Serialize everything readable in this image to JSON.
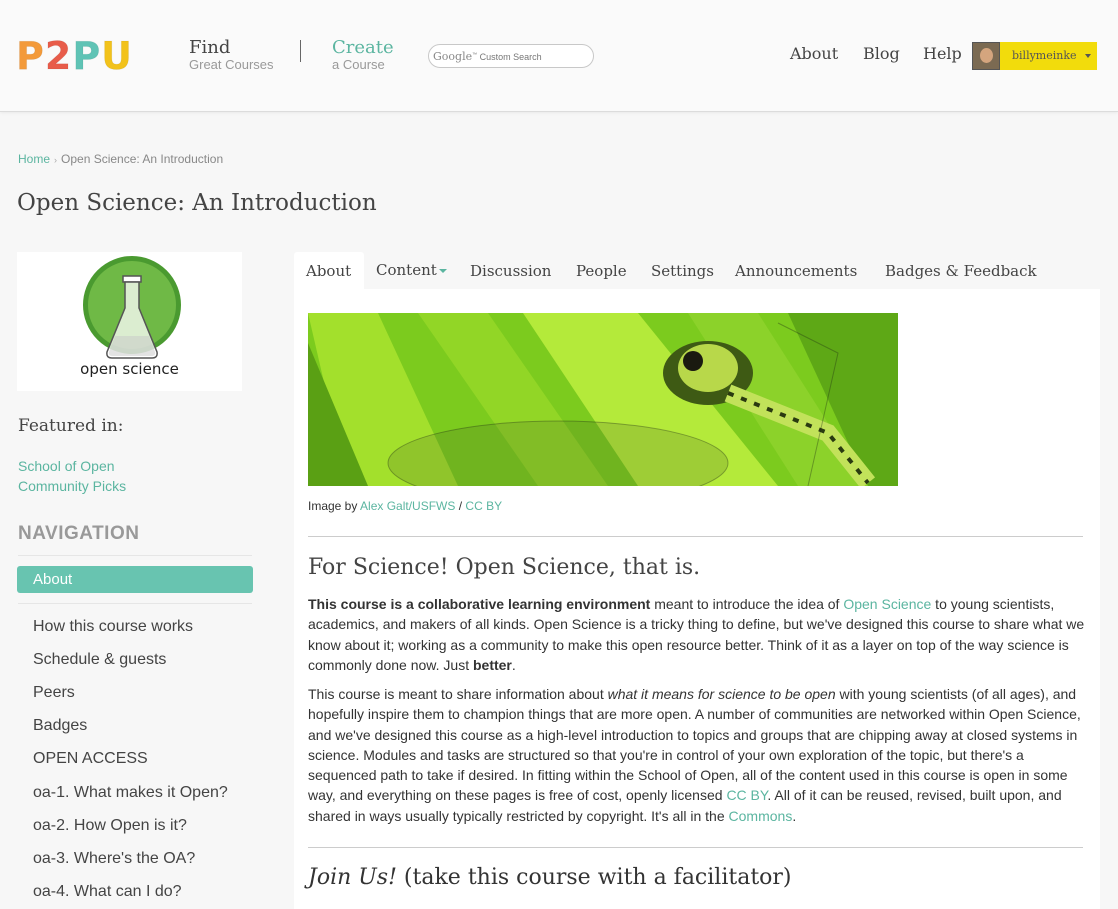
{
  "header": {
    "logo": [
      "P",
      "2",
      "P",
      "U"
    ],
    "find": {
      "title": "Find",
      "subtitle": "Great Courses"
    },
    "create": {
      "title": "Create",
      "subtitle": "a Course"
    },
    "search": {
      "brand": "Google",
      "tm": "™",
      "placeholder": "Custom Search"
    },
    "nav": [
      "About",
      "Blog",
      "Help"
    ],
    "user": {
      "name": "billymeinke"
    }
  },
  "breadcrumb": {
    "home": "Home",
    "current": "Open Science: An Introduction"
  },
  "page_title": "Open Science: An Introduction",
  "sidebar": {
    "course_image_caption": "open science",
    "featured_heading": "Featured in:",
    "featured_links": [
      "School of Open",
      "Community Picks"
    ],
    "nav_heading": "NAVIGATION",
    "active_item": "About",
    "items": [
      "How this course works",
      "Schedule & guests",
      "Peers",
      "Badges",
      "OPEN ACCESS",
      "oa-1. What makes it Open?",
      "oa-2. How Open is it?",
      "oa-3. Where's the OA?",
      "oa-4. What can I do?"
    ]
  },
  "tabs": [
    "About",
    "Content",
    "Discussion",
    "People",
    "Settings",
    "Announcements",
    "Badges & Feedback"
  ],
  "content": {
    "image_credit": {
      "prefix": "Image by ",
      "author": "Alex Galt/USFWS",
      "sep": " / ",
      "license": "CC BY"
    },
    "heading": "For Science! Open Science, that is.",
    "p1": {
      "bold_lead": "This course is a collaborative learning environment",
      "t1": " meant to introduce the idea of ",
      "link": "Open Science",
      "t2": " to young scientists, academics, and makers of all kinds. Open Science is a tricky thing to define, but we've designed this course to share what we know about it; working as a community to make this open resource better. Think of it as a layer on top of the way science is commonly done now. Just ",
      "bold_end": "better",
      "t3": "."
    },
    "p2": {
      "t1": "This course is meant to share information about ",
      "em": "what it means for science to be open",
      "t2": " with young scientists (of all ages), and hopefully inspire them to champion things that are more open. A number of communities are networked within Open Science, and we've designed this course as a high-level introduction to topics and groups that are chipping away at closed systems in science. Modules and tasks are structured so that you're in control of your own exploration of the topic, but there's a sequenced path to take if desired. In fitting within the School of Open, all of the content used in this course is open in some way, and everything on these pages is free of cost, openly licensed ",
      "link1": "CC BY",
      "t3": ". All of it can be reused, revised, built upon, and shared in ways usually typically restricted by copyright. It's all in the ",
      "link2": "Commons",
      "t4": "."
    },
    "join": {
      "em": "Join Us!",
      "rest": " (take this course with a facilitator)"
    }
  },
  "colors": {
    "accent": "#5bb5a0",
    "nav_active": "#68c4b0",
    "user_bg": "#f2dc0c"
  }
}
